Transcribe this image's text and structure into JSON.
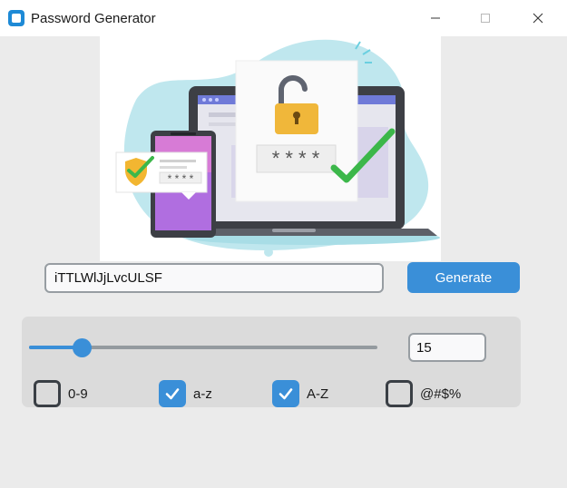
{
  "window": {
    "title": "Password Generator"
  },
  "password": {
    "value": "iTTLWlJjLvcULSF"
  },
  "generate": {
    "label": "Generate"
  },
  "length": {
    "value": "15",
    "slider_min": 0,
    "slider_max": 100,
    "slider_value": 15
  },
  "options": [
    {
      "label": "0-9",
      "checked": false
    },
    {
      "label": "a-z",
      "checked": true
    },
    {
      "label": "A-Z",
      "checked": true
    },
    {
      "label": "@#$%",
      "checked": false
    }
  ],
  "hero": {
    "masked_text_large": "* * * *",
    "masked_text_small": "* * * *"
  },
  "colors": {
    "accent": "#3a8fd8",
    "frame": "#dbdbdb",
    "background": "#ebebeb"
  }
}
